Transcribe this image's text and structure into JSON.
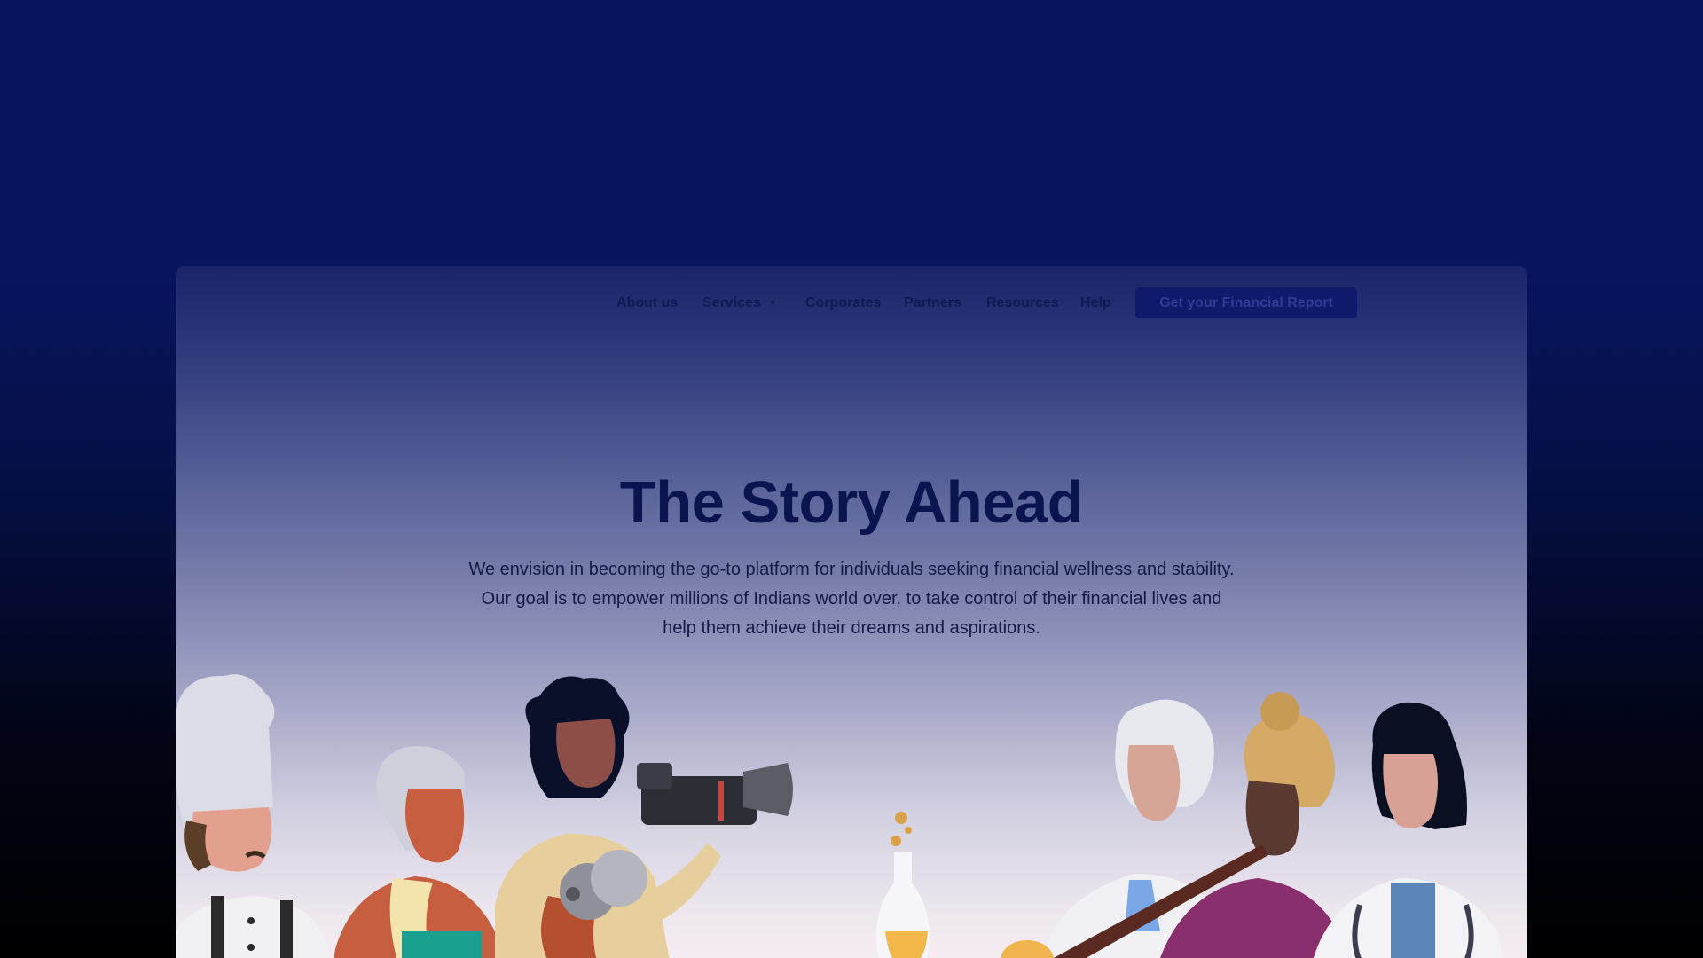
{
  "nav": {
    "items": [
      {
        "label": "About us"
      },
      {
        "label": "Services"
      },
      {
        "label": "Corporates"
      },
      {
        "label": "Partners"
      },
      {
        "label": "Resources"
      },
      {
        "label": "Help"
      }
    ],
    "cta_label": "Get your Financial Report"
  },
  "hero": {
    "title": "The Story Ahead",
    "description": "We envision in becoming the go-to platform for individuals seeking financial wellness and stability. Our goal is to empower millions of Indians world over, to take control of their financial lives and help them achieve their dreams and aspirations."
  },
  "colors": {
    "page_top": "#07155f",
    "page_bottom": "#000000",
    "title": "#0c1450",
    "cta_background": "#101a6a"
  },
  "illustration": {
    "people": [
      "chef",
      "elderly-woman",
      "photographer",
      "scientist",
      "shehnai-player",
      "doctor"
    ]
  }
}
